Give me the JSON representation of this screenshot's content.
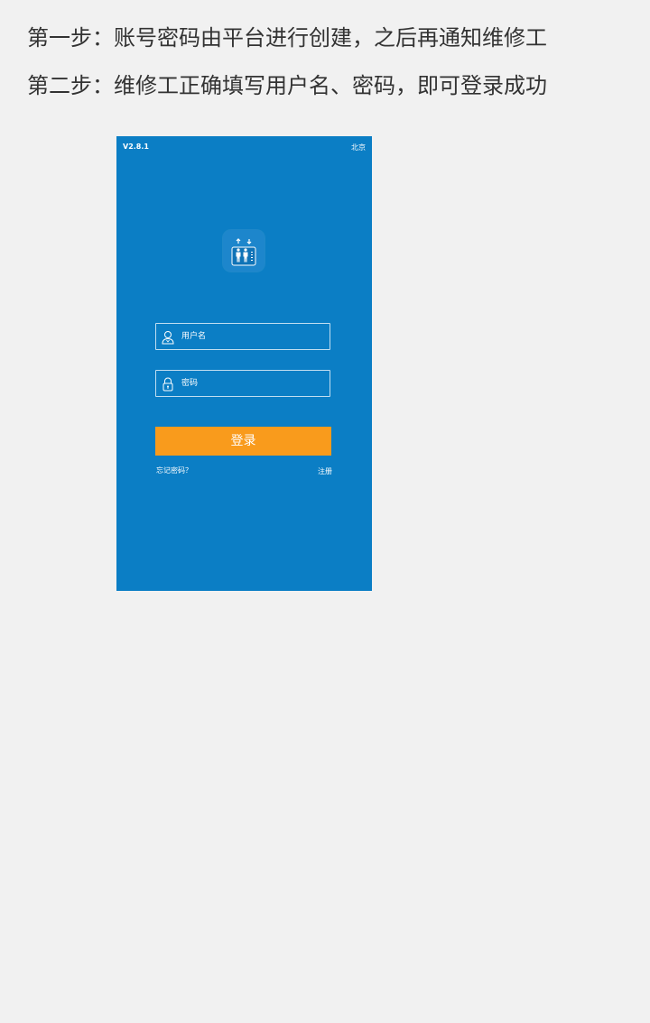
{
  "instructions": {
    "step1": "第一步：账号密码由平台进行创建，之后再通知维修工",
    "step2": "第二步：维修工正确填写用户名、密码，即可登录成功"
  },
  "screenshot": {
    "version": "V2.8.1",
    "city": "北京",
    "username_placeholder": "用户名",
    "password_placeholder": "密码",
    "login_label": "登录",
    "forgot_label": "忘记密码？",
    "register_label": "注册",
    "colors": {
      "background": "#0b7ec5",
      "button": "#f99b1c",
      "page": "#f1f1f1"
    },
    "logo_icon": "elevator-icon"
  }
}
